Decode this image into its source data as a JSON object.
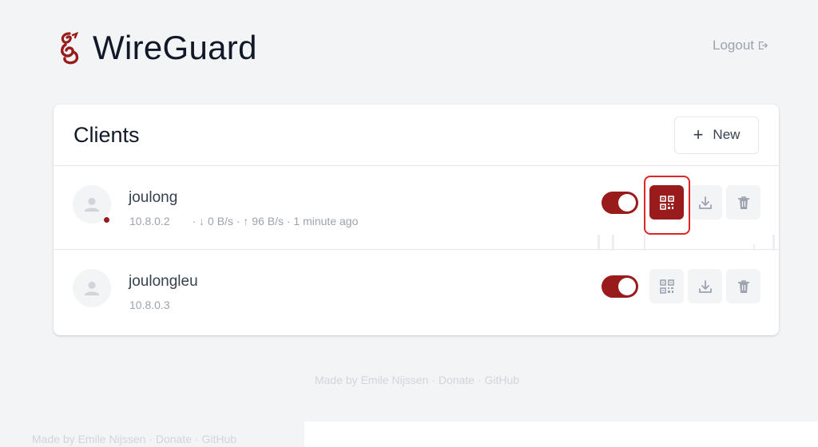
{
  "header": {
    "brand": "WireGuard",
    "logout_label": "Logout",
    "brand_color": "#991b1b"
  },
  "card": {
    "title": "Clients",
    "new_button_label": "New"
  },
  "clients": [
    {
      "name": "joulong",
      "ip": "10.8.0.2",
      "transfer": "· ↓ 0 B/s · ↑ 96 B/s · 1 minute ago",
      "enabled": true,
      "online": true
    },
    {
      "name": "joulongleu",
      "ip": "10.8.0.3",
      "transfer": "",
      "enabled": true,
      "online": false
    }
  ],
  "footer": {
    "prefix": "Made by Emile Nijssen",
    "sep1": " · ",
    "donate": "Donate",
    "sep2": " · ",
    "github": "GitHub"
  },
  "icons": [
    "wireguard-logo-icon",
    "logout-icon",
    "plus-icon",
    "user-icon",
    "qrcode-icon",
    "download-icon",
    "trash-icon"
  ],
  "colors": {
    "accent": "#991b1b",
    "highlight": "#dc2626",
    "background": "#f3f4f6"
  }
}
